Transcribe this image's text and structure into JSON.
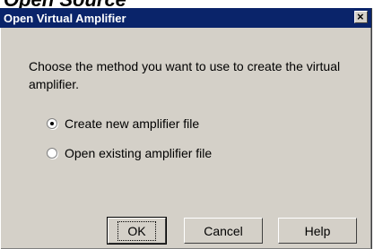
{
  "background_heading": "Open Source",
  "dialog": {
    "title": "Open Virtual Amplifier",
    "close_icon": "close-icon",
    "prompt": "Choose the method you want to use to create the virtual amplifier.",
    "options": [
      {
        "label": "Create new amplifier file",
        "selected": true
      },
      {
        "label": "Open existing amplifier file",
        "selected": false
      }
    ],
    "buttons": {
      "ok": "OK",
      "cancel": "Cancel",
      "help": "Help"
    }
  },
  "colors": {
    "titlebar": "#0a246a",
    "dialog_face": "#d4d0c8"
  }
}
